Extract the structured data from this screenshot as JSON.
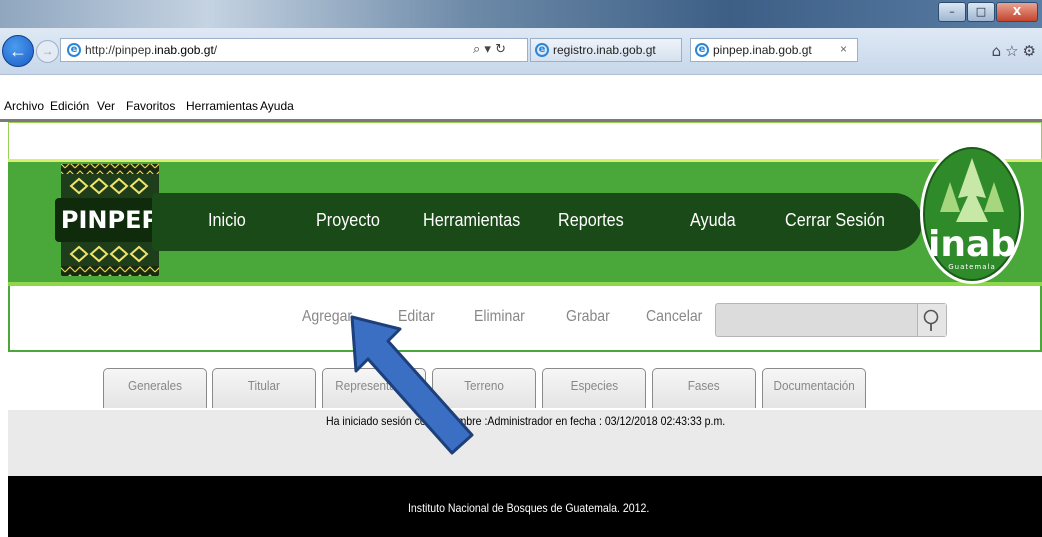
{
  "browser": {
    "window_title": "",
    "address_url_prefix": "http://pinpep.",
    "address_url_domain": "inab.gob.gt",
    "address_url_suffix": "/",
    "address_controls": "⌕ ▾ ↻",
    "tabs": [
      {
        "label": "registro.inab.gob.gt",
        "active": false
      },
      {
        "label": "pinpep.inab.gob.gt",
        "active": true,
        "close": "×"
      }
    ],
    "window_buttons": {
      "minimize": "–",
      "maximize": "□",
      "close": "X"
    },
    "nav_icons": "⌂☆⚙",
    "menu": [
      "Archivo",
      "Edición",
      "Ver",
      "Favoritos",
      "Herramientas",
      "Ayuda"
    ]
  },
  "site": {
    "logo_left_text": "PINPEP",
    "logo_right_text": "inab",
    "logo_right_sub": "Guatemala",
    "nav": [
      "Inicio",
      "Proyecto",
      "Herramientas",
      "Reportes",
      "Ayuda",
      "Cerrar Sesión"
    ],
    "toolbar": [
      "Agregar",
      "Editar",
      "Eliminar",
      "Grabar",
      "Cancelar"
    ],
    "search_placeholder": "",
    "tabs": [
      "Generales",
      "Titular",
      "Representante",
      "Terreno",
      "Especies",
      "Fases",
      "Documentación"
    ],
    "session_text": "Ha iniciado sesión con el nombre :Administrador en fecha : 03/12/2018 02:43:33 p.m.",
    "footer": "Instituto Nacional de Bosques de Guatemala. 2012."
  },
  "colors": {
    "green": "#4aa83a",
    "dark_green": "#1a4a17",
    "arrow_fill": "#3b6fc4"
  }
}
